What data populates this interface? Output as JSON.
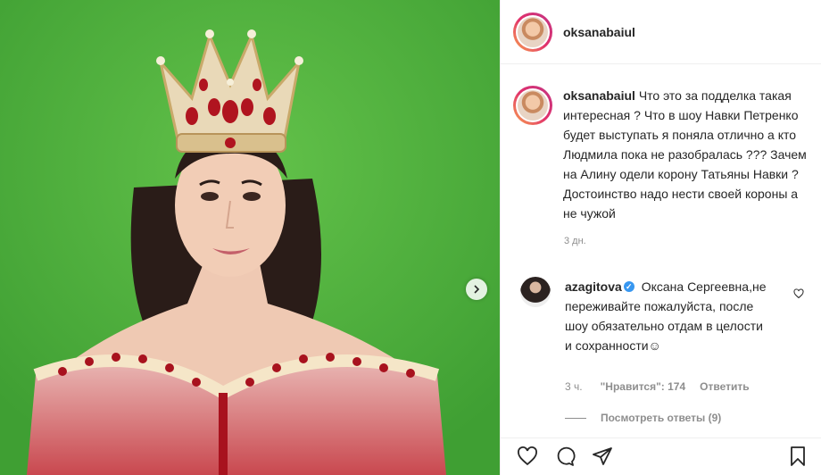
{
  "post": {
    "author": "oksanabaiul",
    "caption": "Что это за подделка такая интересная ? Что в шоу Навки Петренко будет выступать я поняла отлично а кто Людмила пока не разобралась ??? Зачем на Алину одели корону Татьяны Навки ? Достоинство надо нести своей короны а не чужой",
    "time": "3 дн."
  },
  "comment": {
    "author": "azagitova",
    "text": "Оксана Сергеевна,не переживайте пожалуйста, после шоу обязательно отдам в целости и сохранности☺",
    "time": "3 ч.",
    "likes": "\"Нравится\": 174",
    "reply_label": "Ответить",
    "view_replies": "Посмотреть ответы (9)"
  },
  "icons": {
    "next": "chevron-right-icon",
    "like": "heart-icon",
    "comment": "comment-icon",
    "share": "share-icon",
    "save": "bookmark-icon",
    "verified": "verified-badge-icon"
  },
  "colors": {
    "background_green": "#4fb23e",
    "verified_blue": "#3897f0",
    "muted_text": "#8e8e8e"
  }
}
